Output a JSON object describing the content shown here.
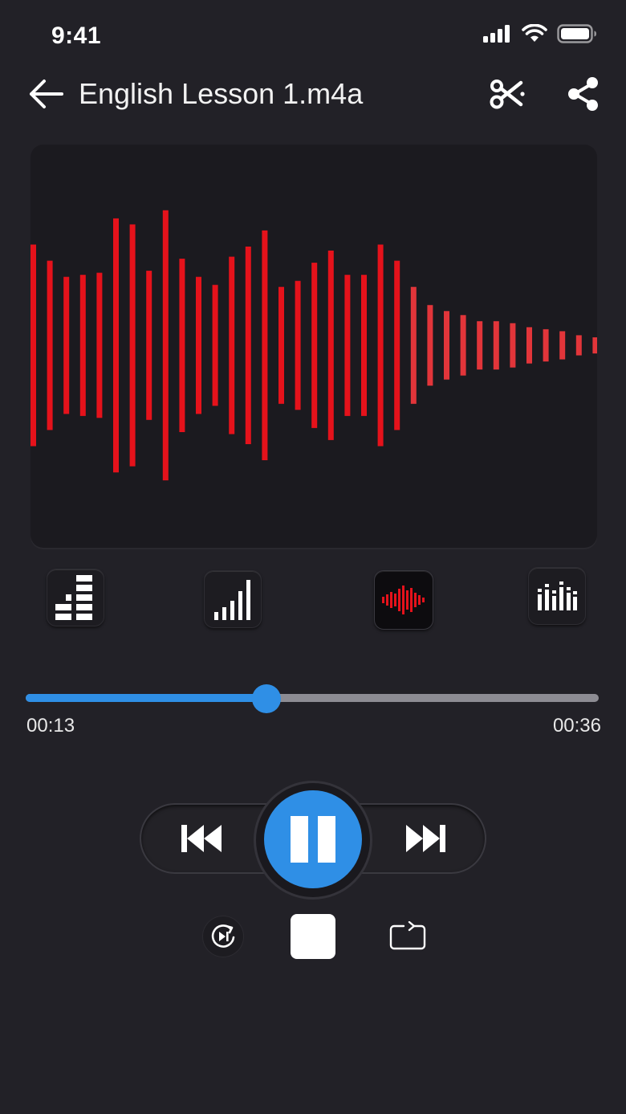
{
  "status_bar": {
    "time": "9:41",
    "icons": [
      "cellular-signal-icon",
      "wifi-icon",
      "battery-icon"
    ]
  },
  "header": {
    "title": "English Lesson 1.m4a",
    "back_icon": "arrow-left-icon",
    "actions": [
      "scissors-trim-icon",
      "share-icon"
    ]
  },
  "waveform": {
    "color": "#e5121b",
    "color_light": "#e2353a",
    "amplitudes": [
      0.5,
      0.42,
      0.34,
      0.35,
      0.36,
      0.63,
      0.6,
      0.37,
      0.67,
      0.43,
      0.34,
      0.3,
      0.44,
      0.49,
      0.57,
      0.29,
      0.32,
      0.41,
      0.47,
      0.35,
      0.35,
      0.5,
      0.42,
      0.29,
      0.2,
      0.17,
      0.15,
      0.12,
      0.12,
      0.11,
      0.09,
      0.08,
      0.07,
      0.05,
      0.04
    ]
  },
  "visualizer_modes": [
    {
      "name": "block-bars-icon",
      "active": false
    },
    {
      "name": "ascending-bars-icon",
      "active": false
    },
    {
      "name": "waveform-icon",
      "active": true
    },
    {
      "name": "dotted-bars-icon",
      "active": false
    }
  ],
  "playback": {
    "current_time": "00:13",
    "total_time": "00:36",
    "progress": 0.42,
    "accent": "#2f8fe6",
    "state": "playing"
  },
  "controls": {
    "prev_icon": "skip-previous-icon",
    "pause_icon": "pause-icon",
    "next_icon": "skip-next-icon",
    "replay_icon": "replay-icon",
    "stop_icon": "stop-icon",
    "loop_icon": "repeat-icon"
  }
}
